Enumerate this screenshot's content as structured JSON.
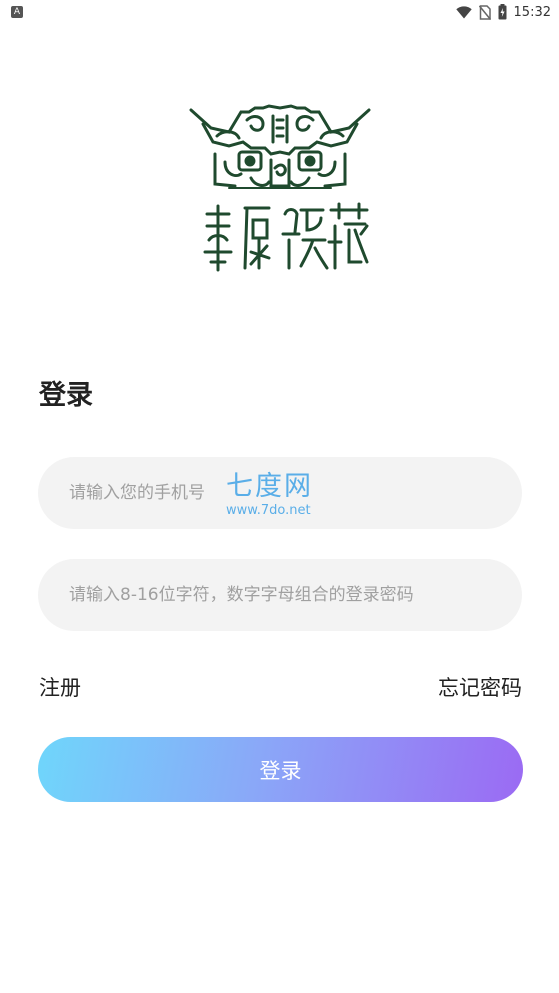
{
  "status_bar": {
    "notification_letter": "A",
    "time": "15:32"
  },
  "logo": {
    "calligraphy_text": "華原臻藏"
  },
  "login": {
    "title": "登录",
    "phone_placeholder": "请输入您的手机号",
    "password_placeholder": "请输入8-16位字符，数字字母组合的登录密码",
    "register_label": "注册",
    "forgot_label": "忘记密码",
    "submit_label": "登录"
  },
  "watermark": {
    "name": "七度网",
    "url": "www.7do.net"
  },
  "colors": {
    "logo_green": "#1f4a2e",
    "field_bg": "#f3f3f3",
    "gradient_start": "#6fd6fb",
    "gradient_end": "#9b6af3",
    "watermark_blue": "#5aaee8"
  },
  "icons": [
    "wifi-icon",
    "no-sim-icon",
    "battery-charging-icon"
  ]
}
